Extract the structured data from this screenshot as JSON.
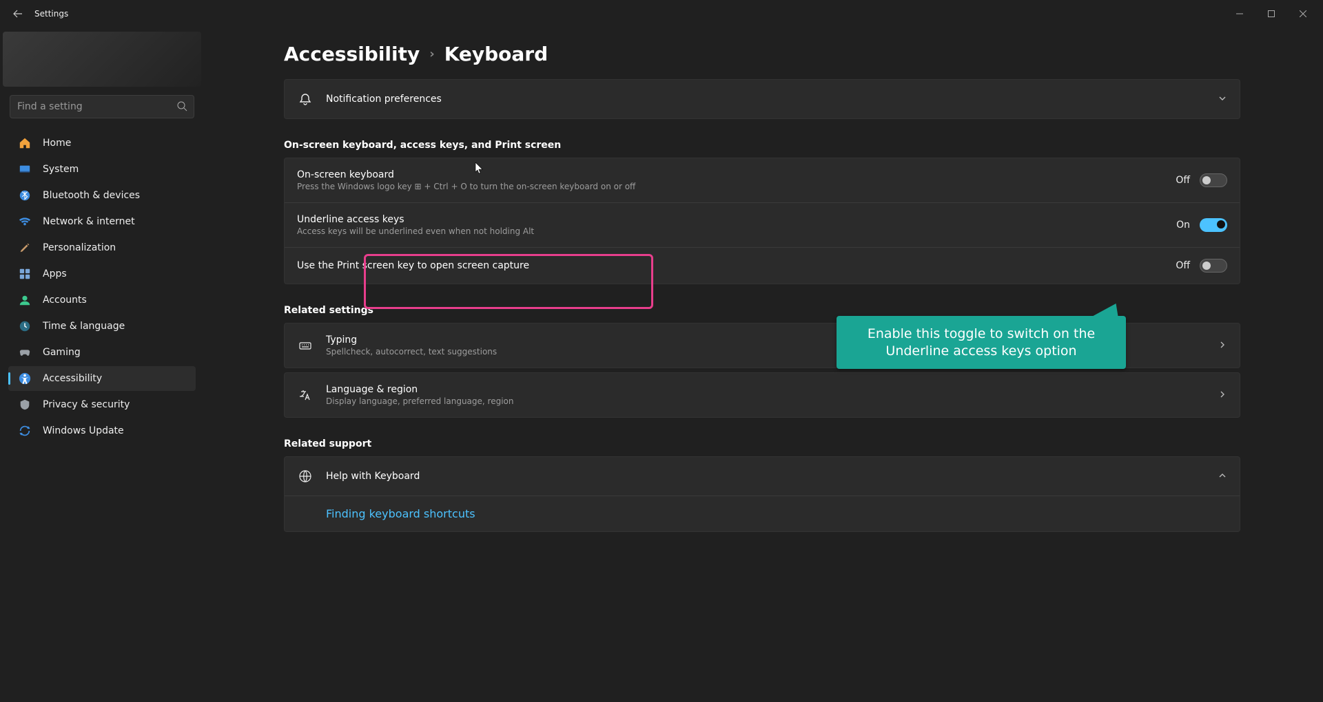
{
  "titlebar": {
    "title": "Settings"
  },
  "search": {
    "placeholder": "Find a setting"
  },
  "nav": {
    "items": [
      {
        "id": "home",
        "label": "Home"
      },
      {
        "id": "system",
        "label": "System"
      },
      {
        "id": "bluetooth",
        "label": "Bluetooth & devices"
      },
      {
        "id": "network",
        "label": "Network & internet"
      },
      {
        "id": "personalization",
        "label": "Personalization"
      },
      {
        "id": "apps",
        "label": "Apps"
      },
      {
        "id": "accounts",
        "label": "Accounts"
      },
      {
        "id": "time",
        "label": "Time & language"
      },
      {
        "id": "gaming",
        "label": "Gaming"
      },
      {
        "id": "accessibility",
        "label": "Accessibility"
      },
      {
        "id": "privacy",
        "label": "Privacy & security"
      },
      {
        "id": "windowsupdate",
        "label": "Windows Update"
      }
    ],
    "active": "accessibility"
  },
  "breadcrumb": {
    "parent": "Accessibility",
    "current": "Keyboard"
  },
  "notification_row": {
    "title": "Notification preferences"
  },
  "section_osk": {
    "heading": "On-screen keyboard, access keys, and Print screen",
    "rows": [
      {
        "title": "On-screen keyboard",
        "sub": "Press the Windows logo key ⊞ + Ctrl + O to turn the on-screen keyboard on or off",
        "state": "off",
        "state_label": "Off"
      },
      {
        "title": "Underline access keys",
        "sub": "Access keys will be underlined even when not holding Alt",
        "state": "on",
        "state_label": "On"
      },
      {
        "title": "Use the Print screen key to open screen capture",
        "sub": "",
        "state": "off",
        "state_label": "Off"
      }
    ]
  },
  "related_settings": {
    "heading": "Related settings",
    "rows": [
      {
        "title": "Typing",
        "sub": "Spellcheck, autocorrect, text suggestions"
      },
      {
        "title": "Language & region",
        "sub": "Display language, preferred language, region"
      }
    ]
  },
  "related_support": {
    "heading": "Related support",
    "rows": [
      {
        "title": "Help with Keyboard"
      }
    ],
    "link": "Finding keyboard shortcuts"
  },
  "callout": {
    "text": "Enable this toggle to switch on the Underline access keys option"
  }
}
